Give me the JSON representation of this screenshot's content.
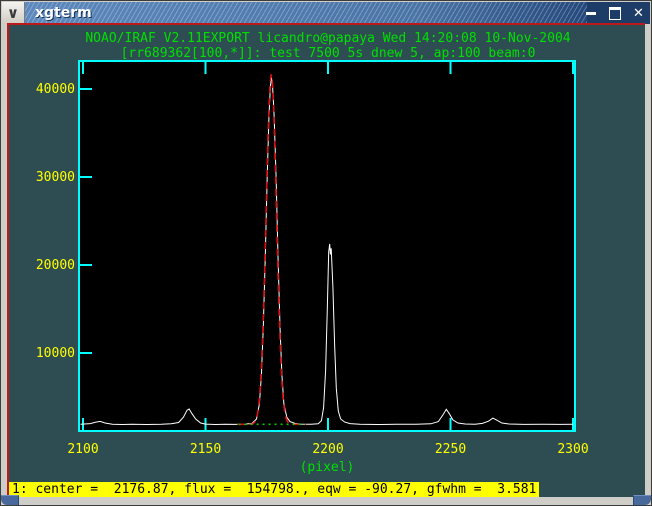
{
  "window": {
    "title": "xgterm",
    "menu_button_glyph": "∨",
    "buttons": {
      "minimize": "minimize",
      "maximize": "maximize",
      "close": "✕"
    }
  },
  "header": {
    "line1": "NOAO/IRAF V2.11EXPORT licandro@papaya Wed 14:20:08 10-Nov-2004",
    "line2": "[rr689362[100,*]]: test 7500 5s dnew 5, ap:100 beam:0"
  },
  "status": {
    "text": "1: center =  2176.87, flux =  154798., eqw = -90.27, gfwhm =  3.581"
  },
  "colors": {
    "terminal_background": "#2e4d52",
    "plot_background": "#000000",
    "axis": "#00ffff",
    "tick_labels": "#ffff00",
    "header_text": "#00e000",
    "spectrum": "#ffffff",
    "fit": "#e01010",
    "continuum": "#00cc00",
    "status_background": "#ffff00",
    "frame_line": "#c01818"
  },
  "chart_data": {
    "type": "line",
    "xlabel": "(pixel)",
    "ylabel": "",
    "x_ticks": [
      2100,
      2150,
      2200,
      2250,
      2300
    ],
    "y_ticks": [
      10000,
      20000,
      30000,
      40000
    ],
    "xlim": [
      2099,
      2300
    ],
    "ylim": [
      1100,
      43200
    ],
    "grid": false,
    "series": [
      {
        "name": "spectrum",
        "color": "#ffffff",
        "style": "solid",
        "points": [
          [
            2099,
            1900
          ],
          [
            2103,
            1980
          ],
          [
            2105,
            2120
          ],
          [
            2107,
            2230
          ],
          [
            2109,
            2050
          ],
          [
            2112,
            1900
          ],
          [
            2116,
            1870
          ],
          [
            2120,
            1900
          ],
          [
            2126,
            1880
          ],
          [
            2132,
            1900
          ],
          [
            2136,
            1950
          ],
          [
            2139,
            2100
          ],
          [
            2141,
            2700
          ],
          [
            2142.5,
            3500
          ],
          [
            2143.3,
            3650
          ],
          [
            2144.5,
            3100
          ],
          [
            2146,
            2500
          ],
          [
            2148,
            2050
          ],
          [
            2150,
            1920
          ],
          [
            2154,
            1880
          ],
          [
            2158,
            1900
          ],
          [
            2162,
            1890
          ],
          [
            2166,
            1920
          ],
          [
            2169,
            2000
          ],
          [
            2170.8,
            2500
          ],
          [
            2172.0,
            4200
          ],
          [
            2172.8,
            7500
          ],
          [
            2173.6,
            13000
          ],
          [
            2174.4,
            21000
          ],
          [
            2175.2,
            30000
          ],
          [
            2175.9,
            37000
          ],
          [
            2176.5,
            40300
          ],
          [
            2176.9,
            41300
          ],
          [
            2177.4,
            40300
          ],
          [
            2178.0,
            37000
          ],
          [
            2178.8,
            30000
          ],
          [
            2179.6,
            21000
          ],
          [
            2180.4,
            13000
          ],
          [
            2181.2,
            7500
          ],
          [
            2182.0,
            4200
          ],
          [
            2183.2,
            2700
          ],
          [
            2184.5,
            2200
          ],
          [
            2186.5,
            2000
          ],
          [
            2189,
            1920
          ],
          [
            2193,
            1900
          ],
          [
            2196,
            1960
          ],
          [
            2197.3,
            2300
          ],
          [
            2198.2,
            3800
          ],
          [
            2199.0,
            8000
          ],
          [
            2199.7,
            15000
          ],
          [
            2200.3,
            21500
          ],
          [
            2200.7,
            22400
          ],
          [
            2201.0,
            21200
          ],
          [
            2201.3,
            21900
          ],
          [
            2202.0,
            17500
          ],
          [
            2202.7,
            11000
          ],
          [
            2203.4,
            6000
          ],
          [
            2204.2,
            3400
          ],
          [
            2205.2,
            2500
          ],
          [
            2206.8,
            2150
          ],
          [
            2209,
            1980
          ],
          [
            2213,
            1900
          ],
          [
            2220,
            1880
          ],
          [
            2228,
            1900
          ],
          [
            2236,
            1900
          ],
          [
            2242,
            1960
          ],
          [
            2245,
            2200
          ],
          [
            2247,
            3000
          ],
          [
            2248.3,
            3600
          ],
          [
            2249.5,
            3100
          ],
          [
            2251,
            2400
          ],
          [
            2253,
            2050
          ],
          [
            2256,
            1930
          ],
          [
            2260,
            1900
          ],
          [
            2263,
            2000
          ],
          [
            2265.5,
            2250
          ],
          [
            2267.3,
            2600
          ],
          [
            2269,
            2350
          ],
          [
            2271,
            2050
          ],
          [
            2274,
            1930
          ],
          [
            2280,
            1890
          ],
          [
            2288,
            1900
          ],
          [
            2295,
            1890
          ],
          [
            2300,
            1900
          ]
        ]
      }
    ],
    "fit": {
      "name": "gaussian-fit",
      "color": "#e01010",
      "style": "dashed",
      "center": 2176.87,
      "gfwhm": 3.581,
      "draw_fwhm": 5.0,
      "peak": 41600,
      "continuum": 1900,
      "range": [
        2163,
        2191
      ]
    },
    "continuum_segment": {
      "name": "continuum",
      "color": "#00cc00",
      "style": "dotted",
      "level": 1900,
      "range": [
        2163.5,
        2190.5
      ]
    }
  }
}
